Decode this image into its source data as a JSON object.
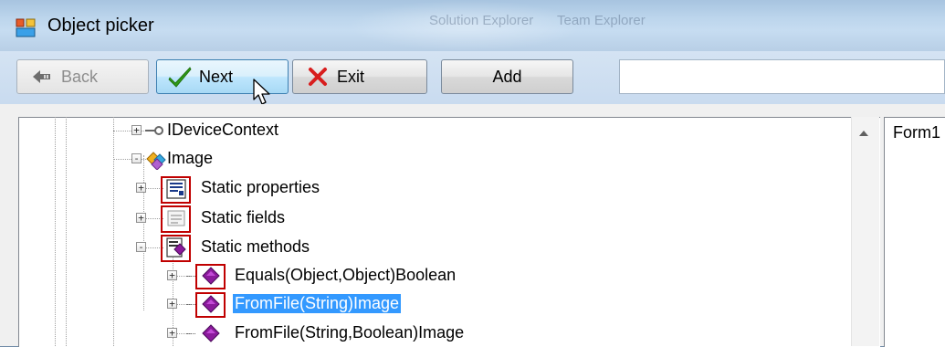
{
  "window": {
    "title": "Object picker",
    "background_ghost_texts": [
      "Solution Explorer",
      "Team Explorer"
    ]
  },
  "toolbar": {
    "back_label": "Back",
    "next_label": "Next",
    "exit_label": "Exit",
    "add_label": "Add",
    "search_value": ""
  },
  "tree": {
    "nodes": [
      {
        "label": "IDeviceContext",
        "expander": "+",
        "icon": "interface-icon"
      },
      {
        "label": "Image",
        "expander": "-",
        "icon": "class-icon"
      },
      {
        "label": "Static properties",
        "expander": "+",
        "icon": "properties-icon"
      },
      {
        "label": "Static fields",
        "expander": "+",
        "icon": "fields-icon"
      },
      {
        "label": "Static methods",
        "expander": "-",
        "icon": "methods-icon"
      },
      {
        "label": "Equals(Object,Object)Boolean",
        "expander": "+",
        "icon": "method-icon"
      },
      {
        "label": "FromFile(String)Image",
        "expander": "+",
        "icon": "method-icon",
        "selected": true
      },
      {
        "label": "FromFile(String,Boolean)Image",
        "expander": "+",
        "icon": "method-icon"
      }
    ]
  },
  "right_panel": {
    "label": "Form1"
  },
  "colors": {
    "selection": "#3399ff",
    "highlight_box": "#c00000",
    "method_icon": "#8b1a9c"
  }
}
